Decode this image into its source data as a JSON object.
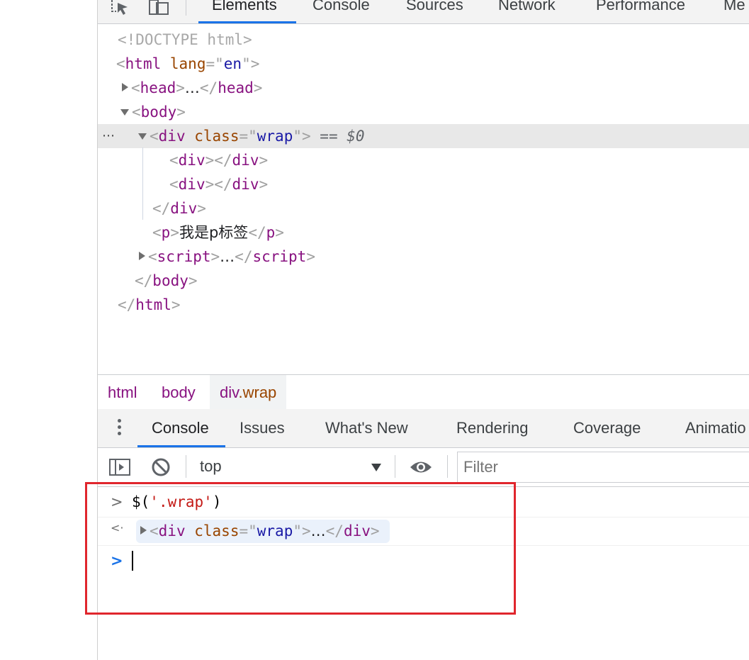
{
  "top_tabs": [
    "Elements",
    "Console",
    "Sources",
    "Network",
    "Performance",
    "Me"
  ],
  "icons": {
    "inspect": "inspect-element-icon",
    "device": "device-toggle-icon"
  },
  "dom_tree": {
    "doctype": "<!DOCTYPE html>",
    "html_open_tag": "html",
    "lang_attr": "lang",
    "lang_val": "en",
    "head_tag": "head",
    "body_tag": "body",
    "div_tag": "div",
    "class_attr": "class",
    "wrap_val": "wrap",
    "dollar0": "== $0",
    "selected_dots": "⋯",
    "p_tag": "p",
    "p_text": "我是p标签",
    "script_tag": "script",
    "ellipsis": "…"
  },
  "breadcrumbs": {
    "html": "html",
    "body": "body",
    "divwrap_tag": "div",
    "divwrap_class": ".wrap"
  },
  "drawer_tabs": [
    "Console",
    "Issues",
    "What's New",
    "Rendering",
    "Coverage",
    "Animatio"
  ],
  "console_toolbar": {
    "context": "top",
    "filter_placeholder": "Filter"
  },
  "console": {
    "input_dollar": "$(",
    "input_string": "'.wrap'",
    "input_close": ")",
    "prompt_symbol": ">",
    "result_symbol": "<·"
  },
  "colors": {
    "accent": "#1a73e8",
    "highlight_box": "#e0262d",
    "tag": "#881280",
    "attr": "#994500",
    "value": "#1a1aa6"
  }
}
